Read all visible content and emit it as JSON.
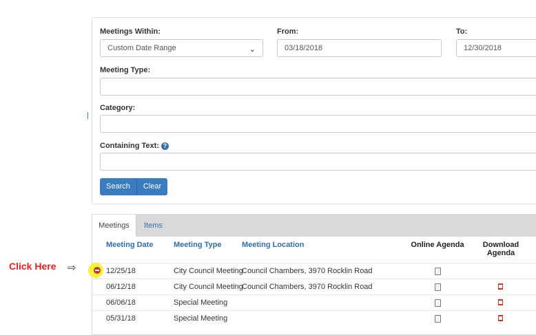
{
  "filters": {
    "meetings_within_label": "Meetings Within:",
    "meetings_within_value": "Custom Date Range",
    "from_label": "From:",
    "from_value": "03/18/2018",
    "to_label": "To:",
    "to_value": "12/30/2018",
    "meeting_type_label": "Meeting Type:",
    "category_label": "Category:",
    "containing_text_label": "Containing Text:",
    "help_glyph": "?",
    "search_label": "Search",
    "clear_label": "Clear"
  },
  "tabs": {
    "meetings": "Meetings",
    "items": "Items"
  },
  "table": {
    "headers": {
      "date": "Meeting Date",
      "type": "Meeting Type",
      "location": "Meeting Location",
      "online": "Online Agenda",
      "download": "Download Agenda"
    },
    "rows": [
      {
        "date": "12/25/18",
        "type": "City Council Meeting",
        "location": "Council Chambers, 3970 Rocklin Road",
        "online": true,
        "download": false
      },
      {
        "date": "06/12/18",
        "type": "City Council Meeting",
        "location": "Council Chambers, 3970 Rocklin Road",
        "online": true,
        "download": true
      },
      {
        "date": "06/06/18",
        "type": "Special Meeting",
        "location": "",
        "online": true,
        "download": true
      },
      {
        "date": "05/31/18",
        "type": "Special Meeting",
        "location": "",
        "online": true,
        "download": true
      }
    ]
  },
  "annotation": {
    "text": "Click Here",
    "arrow": "⇨"
  },
  "colors": {
    "accent": "#3b7bbf",
    "link": "#2f6fad",
    "annotation": "#e02020",
    "highlight": "#f5f03a"
  }
}
